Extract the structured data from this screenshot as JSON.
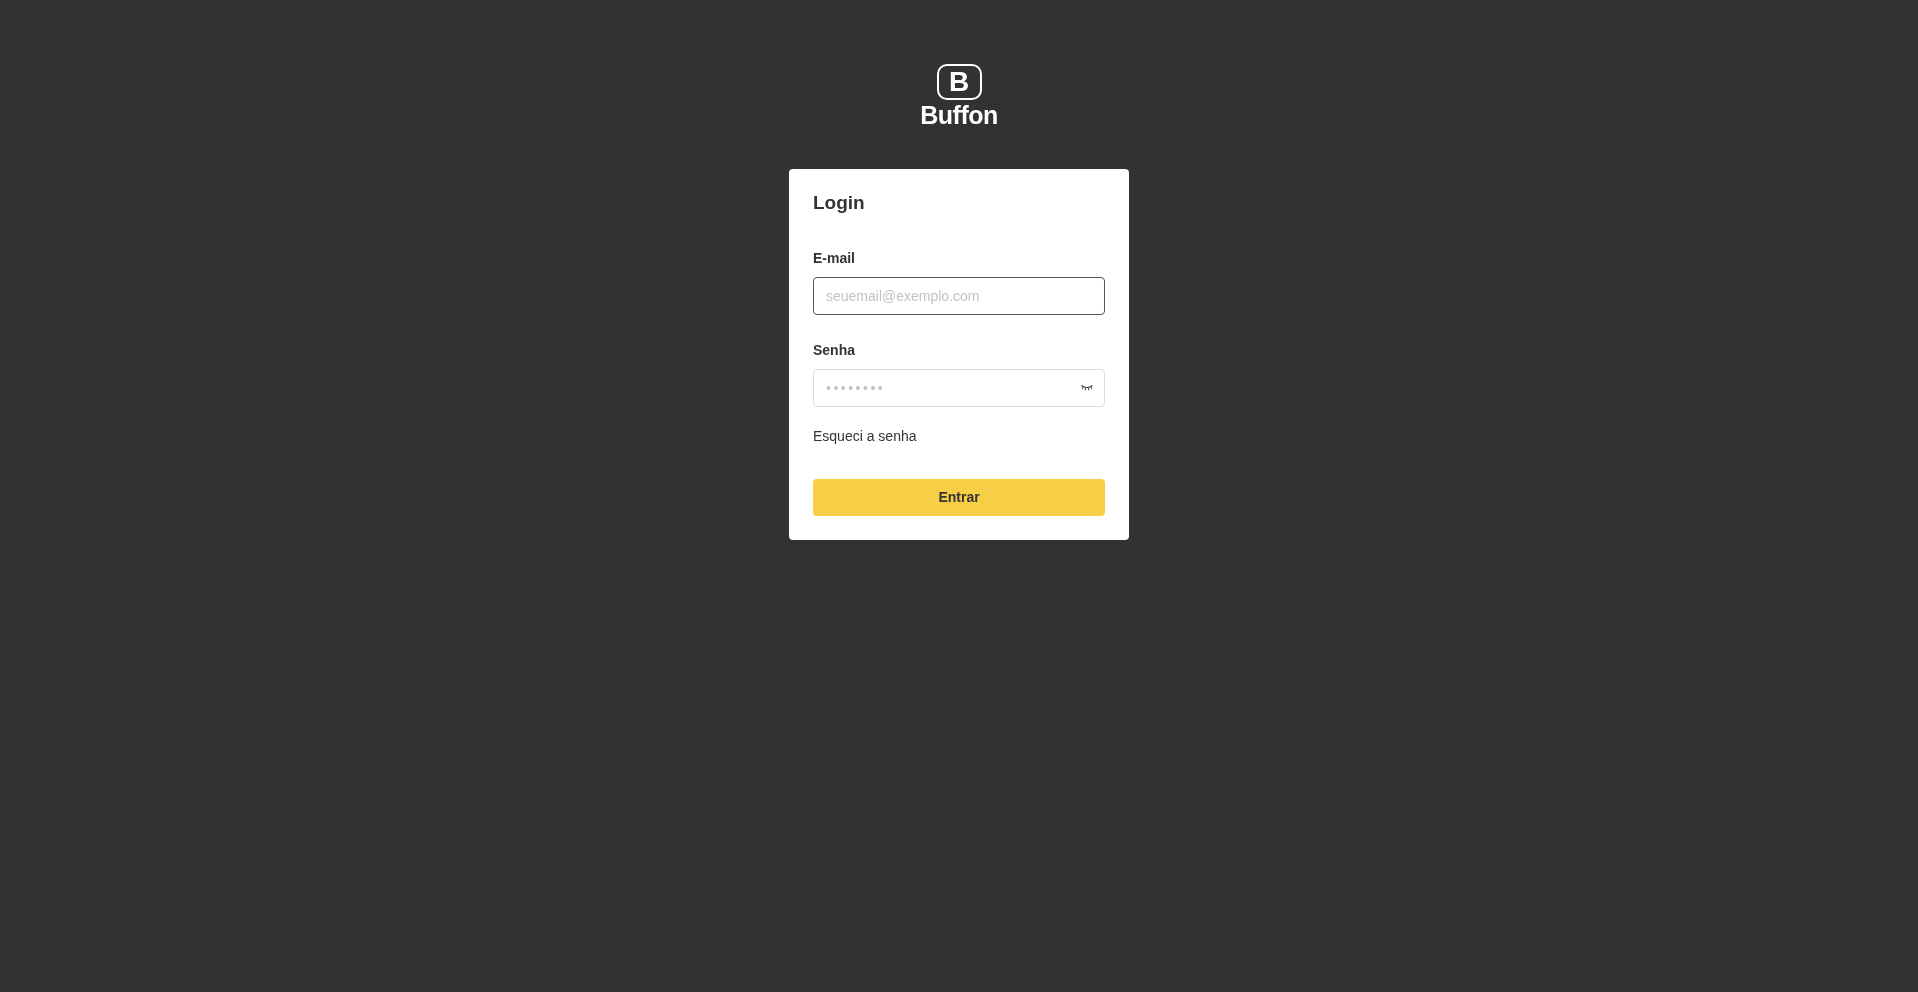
{
  "logo": {
    "mark": "B",
    "name": "Buffon"
  },
  "login_form": {
    "title": "Login",
    "fields": [
      {
        "kind": "email",
        "label": "E-mail",
        "placeholder": "seuemail@exemplo.com",
        "focused": true
      },
      {
        "kind": "password",
        "label": "Senha",
        "placeholder": "••••••••",
        "focused": false
      }
    ],
    "forgot_link": "Esqueci a senha",
    "submit_button": "Entrar"
  }
}
